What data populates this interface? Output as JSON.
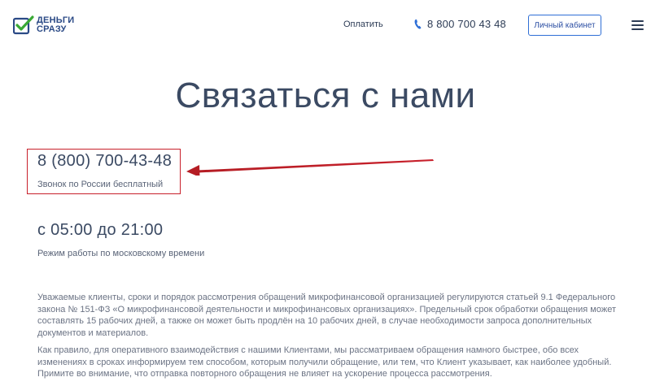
{
  "header": {
    "logo": {
      "line1": "ДЕНЬГИ",
      "line2": "СРАЗУ",
      "color_green": "#3aa935",
      "color_blue": "#2b4a86"
    },
    "nav_pay_label": "Оплатить",
    "phone": "8 800 700 43 48",
    "cabinet_button_label": "Личный кабинет",
    "accent_color": "#2f6fd6"
  },
  "main": {
    "title": "Связаться с нами",
    "contact_phone": "8 (800) 700-43-48",
    "contact_phone_note": "Звонок по России бесплатный",
    "highlight_color": "#c8202b",
    "hours": "с 05:00 до 21:00",
    "hours_note": "Режим работы по московскому времени",
    "paragraph_1": "Уважаемые клиенты, сроки и порядок рассмотрения обращений микрофинансовой организацией регулируются статьей 9.1 Федерального закона № 151-ФЗ «О микрофинансовой деятельности и микрофинансовых организациях». Предельный срок обработки обращения может составлять 15 рабочих дней, а также он может быть продлён на 10 рабочих дней, в случае необходимости запроса дополнительных документов и материалов.",
    "paragraph_2": "Как правило, для оперативного взаимодействия с нашими Клиентами, мы рассматриваем обращения намного быстрее, обо всех изменениях в сроках информируем тем способом, которым получили обращение, или тем, что Клиент указывает, как наиболее удобный. Примите во внимание, что отправка повторного обращения не влияет на ускорение процесса рассмотрения."
  }
}
